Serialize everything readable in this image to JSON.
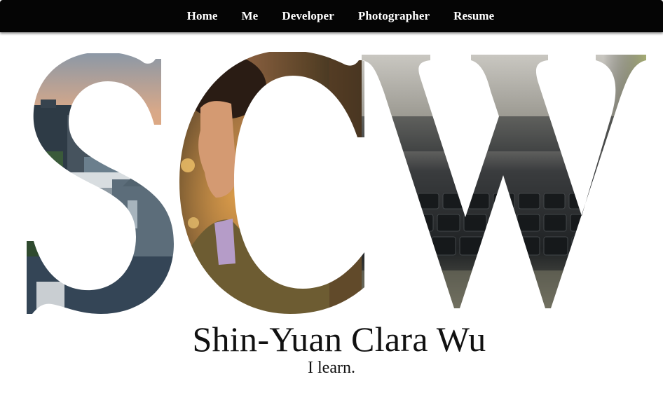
{
  "nav": {
    "items": [
      {
        "label": "Home"
      },
      {
        "label": "Me"
      },
      {
        "label": "Developer"
      },
      {
        "label": "Photographer"
      },
      {
        "label": "Resume"
      }
    ]
  },
  "hero": {
    "letters": "SCW",
    "image_themes": [
      "city-skyline-sunset-photo",
      "portrait-photo",
      "laptop-keyboard-photo"
    ]
  },
  "profile": {
    "name": "Shin-Yuan Clara Wu",
    "tagline": "I learn."
  },
  "colors": {
    "navbar_bg": "#050505",
    "nav_text": "#ffffff",
    "page_bg": "#ffffff",
    "text": "#111111"
  }
}
